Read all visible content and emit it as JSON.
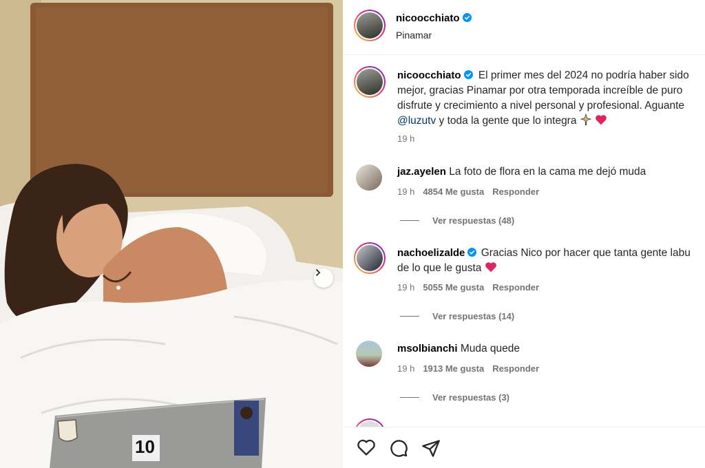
{
  "post": {
    "author": "nicoocchiato",
    "location": "Pinamar",
    "caption_parts": {
      "line1": "El primer mes del 2024 no podría haber sido",
      "line2": "mejor, gracias Pinamar por otra temporada increíble de puro",
      "line3": "disfrute y crecimiento a nivel personal y profesional. Aguante",
      "mention": "@luzutv",
      "line4_rest": " y toda la gente que lo integra "
    },
    "time": "19 h"
  },
  "comments": [
    {
      "user": "jaz.ayelen",
      "text": "La foto de flora en la cama me dejó muda",
      "time": "19 h",
      "likes": "4854 Me gusta",
      "reply": "Responder",
      "view_replies": "Ver respuestas (48)"
    },
    {
      "user": "nachoelizalde",
      "text_line1": "Gracias Nico por hacer que tanta gente labu",
      "text_line2": "de lo que le gusta",
      "time": "19 h",
      "likes": "5055 Me gusta",
      "reply": "Responder",
      "view_replies": "Ver respuestas (14)"
    },
    {
      "user": "msolbianchi",
      "text": "Muda quede",
      "time": "19 h",
      "likes": "1913 Me gusta",
      "reply": "Responder",
      "view_replies": "Ver respuestas (3)"
    }
  ],
  "laptop_sticker": "10",
  "icons": {
    "verified": "verified-badge-icon",
    "like": "heart-icon",
    "comment": "comment-icon",
    "share": "share-icon",
    "next": "chevron-right-icon"
  },
  "colors": {
    "verified": "#0095f6",
    "heart": "#e0245e",
    "muted": "#737373"
  }
}
